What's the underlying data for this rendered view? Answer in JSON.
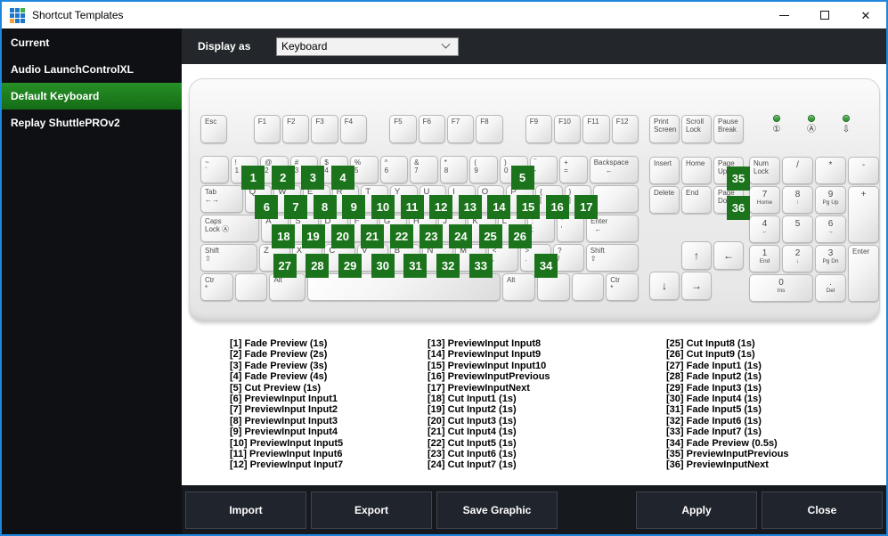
{
  "window": {
    "title": "Shortcut Templates",
    "app_icon_colors": [
      [
        "#1e78c8",
        "#1e78c8",
        "#3faf46"
      ],
      [
        "#1e78c8",
        "#1e78c8",
        "#1e78c8"
      ],
      [
        "#f0a23c",
        "#1e78c8",
        "#1e78c8"
      ]
    ],
    "controls": {
      "minimize": "minimize",
      "maximize": "maximize",
      "close": "✕"
    }
  },
  "colors": {
    "accent_green": "#1b741b",
    "selected_green": "#1d7d1d",
    "window_border_blue": "#1e86dc",
    "footer_bg": "#16191d"
  },
  "sidebar": {
    "items": [
      {
        "label": "Current",
        "selected": false
      },
      {
        "label": "Audio LaunchControlXL",
        "selected": false
      },
      {
        "label": "Default Keyboard",
        "selected": true
      },
      {
        "label": "Replay ShuttlePROv2",
        "selected": false
      }
    ]
  },
  "topbar": {
    "label": "Display as",
    "value": "Keyboard"
  },
  "keyboard": {
    "frow": [
      {
        "t": [
          "Esc"
        ],
        "c": "ctl"
      },
      {
        "sp": 0.9
      },
      {
        "t": [
          "F1"
        ],
        "c": "ctl"
      },
      {
        "t": [
          "F2"
        ],
        "c": "ctl"
      },
      {
        "t": [
          "F3"
        ],
        "c": "ctl"
      },
      {
        "t": [
          "F4"
        ],
        "c": "ctl"
      },
      {
        "sp": 0.75
      },
      {
        "t": [
          "F5"
        ],
        "c": "ctl"
      },
      {
        "t": [
          "F6"
        ],
        "c": "ctl"
      },
      {
        "t": [
          "F7"
        ],
        "c": "ctl"
      },
      {
        "t": [
          "F8"
        ],
        "c": "ctl"
      },
      {
        "sp": 0.75
      },
      {
        "t": [
          "F9"
        ],
        "c": "ctl"
      },
      {
        "t": [
          "F10"
        ],
        "c": "ctl"
      },
      {
        "t": [
          "F11"
        ],
        "c": "ctl"
      },
      {
        "t": [
          "F12"
        ],
        "c": "ctl"
      }
    ],
    "rows": [
      [
        {
          "t": [
            "~",
            "`"
          ],
          "n": "backquote"
        },
        {
          "t": [
            "!",
            "1"
          ],
          "b": 1
        },
        {
          "t": [
            "@",
            "2"
          ],
          "b": 2
        },
        {
          "t": [
            "#",
            "3"
          ],
          "b": 3
        },
        {
          "t": [
            "$",
            "4"
          ],
          "b": 4
        },
        {
          "t": [
            "%",
            "5"
          ]
        },
        {
          "t": [
            "^",
            "6"
          ]
        },
        {
          "t": [
            "&",
            "7"
          ]
        },
        {
          "t": [
            "*",
            "8"
          ],
          "n": "8"
        },
        {
          "t": [
            "(",
            "9"
          ],
          "b": null
        },
        {
          "t": [
            ")",
            "0"
          ],
          "b": 5
        },
        {
          "t": [
            "‾",
            "-"
          ],
          "n": "minus"
        },
        {
          "t": [
            "+",
            "="
          ],
          "n": "equals"
        },
        {
          "t": [
            "Backspace",
            "      ←"
          ],
          "c": "ctl",
          "u": 1.8,
          "n": "backspace"
        }
      ],
      [
        {
          "t": [
            "Tab",
            "←→"
          ],
          "c": "ctl",
          "u": 1.6,
          "n": "tab"
        },
        {
          "t": [
            "Q"
          ],
          "c": "ltr",
          "b": 6
        },
        {
          "t": [
            "W"
          ],
          "c": "ltr",
          "b": 7
        },
        {
          "t": [
            "E"
          ],
          "c": "ltr",
          "b": 8
        },
        {
          "t": [
            "R"
          ],
          "c": "ltr",
          "b": 9
        },
        {
          "t": [
            "T"
          ],
          "c": "ltr",
          "b": 10
        },
        {
          "t": [
            "Y"
          ],
          "c": "ltr",
          "b": 11
        },
        {
          "t": [
            "U"
          ],
          "c": "ltr",
          "b": 12
        },
        {
          "t": [
            "I"
          ],
          "c": "ltr",
          "b": 13
        },
        {
          "t": [
            "O"
          ],
          "c": "ltr",
          "b": 14
        },
        {
          "t": [
            "P"
          ],
          "c": "ltr",
          "b": 15
        },
        {
          "t": [
            "{",
            "["
          ],
          "b": 16,
          "n": "bracket-left"
        },
        {
          "t": [
            "}",
            "]"
          ],
          "b": 17,
          "n": "bracket-right"
        },
        {
          "t": [],
          "u": 1.7,
          "n": "backslash"
        }
      ],
      [
        {
          "t": [
            "Caps",
            "Lock Ⓐ"
          ],
          "c": "ctl",
          "u": 2.2,
          "n": "caps-lock"
        },
        {
          "t": [
            "A"
          ],
          "c": "ltr",
          "b": 18
        },
        {
          "t": [
            "S"
          ],
          "c": "ltr",
          "b": 19
        },
        {
          "t": [
            "D"
          ],
          "c": "ltr",
          "b": 20
        },
        {
          "t": [
            "F"
          ],
          "c": "ltr",
          "b": 21
        },
        {
          "t": [
            "G"
          ],
          "c": "ltr",
          "b": 22
        },
        {
          "t": [
            "H"
          ],
          "c": "ltr",
          "b": 23
        },
        {
          "t": [
            "J"
          ],
          "c": "ltr",
          "b": 24
        },
        {
          "t": [
            "K"
          ],
          "c": "ltr",
          "b": 25
        },
        {
          "t": [
            "L"
          ],
          "c": "ltr",
          "b": 26
        },
        {
          "t": [
            ":",
            ";"
          ],
          "n": "semicolon"
        },
        {
          "t": [
            "\"",
            "'"
          ],
          "n": "quote"
        },
        {
          "t": [
            "Enter",
            "  ←"
          ],
          "c": "ctl",
          "u": 1.95,
          "n": "enter"
        }
      ],
      [
        {
          "t": [
            "Shift",
            "⇧"
          ],
          "c": "ctl",
          "u": 1.9,
          "n": "shift-left"
        },
        {
          "t": [
            "Z"
          ],
          "c": "ltr",
          "b": 27
        },
        {
          "t": [
            "X"
          ],
          "c": "ltr",
          "b": 28
        },
        {
          "t": [
            "C"
          ],
          "c": "ltr",
          "b": 29
        },
        {
          "t": [
            "V"
          ],
          "c": "ltr",
          "b": 30
        },
        {
          "t": [
            "B"
          ],
          "c": "ltr",
          "b": 31
        },
        {
          "t": [
            "N"
          ],
          "c": "ltr",
          "b": 32
        },
        {
          "t": [
            "M"
          ],
          "c": "ltr",
          "b": 33
        },
        {
          "t": [
            "<",
            ","
          ],
          "n": "comma"
        },
        {
          "t": [
            ">",
            "."
          ],
          "b": 34,
          "n": "period"
        },
        {
          "t": [
            "?",
            "/"
          ],
          "n": "slash"
        },
        {
          "t": [
            "Shift",
            "⇧"
          ],
          "c": "ctl",
          "u": 1.75,
          "n": "shift-right"
        }
      ],
      [
        {
          "t": [
            "Ctr",
            "*"
          ],
          "c": "ctl",
          "n": "ctr-left"
        },
        {
          "t": [],
          "n": "blank"
        },
        {
          "t": [
            "Alt"
          ],
          "c": "ctl",
          "u": 1.1,
          "n": "alt-left"
        },
        {
          "t": [],
          "u": 6.2,
          "n": "space"
        },
        {
          "t": [
            "Alt"
          ],
          "c": "ctl",
          "n": "alt-right"
        },
        {
          "t": [],
          "n": "blank"
        },
        {
          "t": [],
          "n": "blank"
        },
        {
          "t": [
            "Ctr",
            "*"
          ],
          "c": "ctl",
          "n": "ctr-right"
        }
      ]
    ],
    "nav_top": [
      {
        "t": [
          "Print",
          "Screen"
        ],
        "c": "ctl",
        "n": "print-screen"
      },
      {
        "t": [
          "Scroll",
          "Lock"
        ],
        "c": "ctl",
        "n": "scroll-lock"
      },
      {
        "t": [
          "Pause",
          "Break"
        ],
        "c": "ctl",
        "n": "pause-break"
      }
    ],
    "nav_mid": [
      {
        "t": [
          "Insert"
        ],
        "c": "ctl"
      },
      {
        "t": [
          "Home"
        ],
        "c": "ctl"
      },
      {
        "t": [
          "Page",
          "Up"
        ],
        "c": "ctl",
        "b": 35,
        "n": "page-up"
      },
      {
        "t": [
          "Delete"
        ],
        "c": "ctl"
      },
      {
        "t": [
          "End"
        ],
        "c": "ctl"
      },
      {
        "t": [
          "Page",
          "Down"
        ],
        "c": "ctl",
        "b": 36,
        "n": "page-down"
      }
    ],
    "leds": [
      {
        "symbol": "①",
        "n": "num-lock-led"
      },
      {
        "symbol": "Ⓐ",
        "n": "caps-lock-led"
      },
      {
        "symbol": "⇩",
        "n": "scroll-lock-led"
      }
    ],
    "arrows": [
      {
        "t": [
          "↑"
        ],
        "c": "arr",
        "n": "arrow-up",
        "gc": 2
      },
      {
        "t": [
          "←"
        ],
        "c": "arr",
        "n": "arrow-left"
      },
      {
        "t": [
          "↓"
        ],
        "c": "arr",
        "n": "arrow-down"
      },
      {
        "t": [
          "→"
        ],
        "c": "arr",
        "n": "arrow-right"
      }
    ],
    "numpad": [
      {
        "t": [
          "Num",
          "Lock"
        ],
        "c": "ctl",
        "n": "numpad-num-lock"
      },
      {
        "t": [
          "/"
        ],
        "c": "np",
        "n": "numpad-divide"
      },
      {
        "t": [
          "*"
        ],
        "c": "np",
        "n": "numpad-multiply"
      },
      {
        "t": [
          "-"
        ],
        "c": "np",
        "n": "numpad-subtract"
      },
      {
        "t": [
          "7",
          "Home"
        ],
        "c": "np"
      },
      {
        "t": [
          "8",
          "↑"
        ],
        "c": "np",
        "n": "numpad-8"
      },
      {
        "t": [
          "9",
          "Pg Up"
        ],
        "c": "np"
      },
      {
        "t": [
          "+"
        ],
        "c": "np",
        "tall": true,
        "n": "numpad-add"
      },
      {
        "t": [
          "4",
          "←"
        ],
        "c": "np",
        "n": "numpad-4"
      },
      {
        "t": [
          "5"
        ],
        "c": "np",
        "n": "numpad-5"
      },
      {
        "t": [
          "6",
          "→"
        ],
        "c": "np",
        "n": "numpad-6"
      },
      {
        "t": [
          "1",
          "End"
        ],
        "c": "np"
      },
      {
        "t": [
          "2",
          "↓"
        ],
        "c": "np",
        "n": "numpad-2"
      },
      {
        "t": [
          "3",
          "Pg Dn"
        ],
        "c": "np"
      },
      {
        "t": [
          "Enter"
        ],
        "c": "ctl",
        "tall": true,
        "n": "numpad-enter"
      },
      {
        "t": [
          "0",
          "Ins"
        ],
        "c": "np",
        "wide": true
      },
      {
        "t": [
          ".",
          "Del"
        ],
        "c": "np",
        "n": "numpad-decimal"
      }
    ]
  },
  "legend": {
    "columns": [
      [
        "[1] Fade Preview (1s)",
        "[2] Fade Preview (2s)",
        "[3] Fade Preview (3s)",
        "[4] Fade Preview (4s)",
        "[5] Cut Preview (1s)",
        "[6] PreviewInput Input1",
        "[7] PreviewInput Input2",
        "[8] PreviewInput Input3",
        "[9] PreviewInput Input4",
        "[10] PreviewInput Input5",
        "[11] PreviewInput Input6",
        "[12] PreviewInput Input7"
      ],
      [
        "[13] PreviewInput Input8",
        "[14] PreviewInput Input9",
        "[15] PreviewInput Input10",
        "[16] PreviewInputPrevious",
        "[17] PreviewInputNext",
        "[18] Cut Input1 (1s)",
        "[19] Cut Input2 (1s)",
        "[20] Cut Input3 (1s)",
        "[21] Cut Input4 (1s)",
        "[22] Cut Input5 (1s)",
        "[23] Cut Input6 (1s)",
        "[24] Cut Input7 (1s)"
      ],
      [
        "[25] Cut Input8 (1s)",
        "[26] Cut Input9 (1s)",
        "[27] Fade Input1 (1s)",
        "[28] Fade Input2 (1s)",
        "[29] Fade Input3 (1s)",
        "[30] Fade Input4 (1s)",
        "[31] Fade Input5 (1s)",
        "[32] Fade Input6 (1s)",
        "[33] Fade Input7 (1s)",
        "[34] Fade Preview (0.5s)",
        "[35] PreviewInputPrevious",
        "[36] PreviewInputNext"
      ]
    ]
  },
  "footer": {
    "buttons": [
      "Import",
      "Export",
      "Save Graphic",
      "Apply",
      "Close"
    ]
  }
}
